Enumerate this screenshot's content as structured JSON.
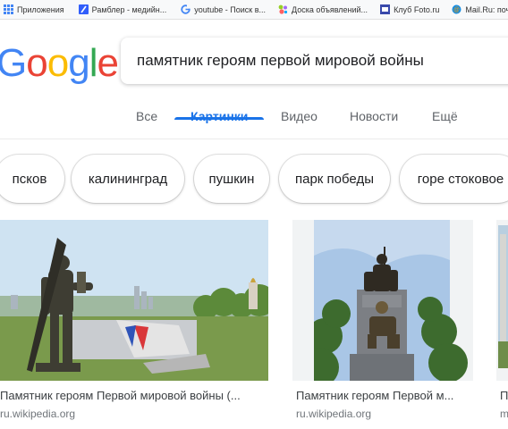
{
  "bookmarks": [
    {
      "label": "Приложения",
      "icon": "apps-grid-icon",
      "color": "#4285f4"
    },
    {
      "label": "Рамблер - медийн...",
      "icon": "rambler-icon",
      "color": "#315efb"
    },
    {
      "label": "youtube - Поиск в...",
      "icon": "google-g-icon",
      "color": "#4285f4"
    },
    {
      "label": "Доска объявлений...",
      "icon": "avito-icon",
      "color": "#e53935"
    },
    {
      "label": "Клуб Foto.ru",
      "icon": "foto-icon",
      "color": "#3949ab"
    },
    {
      "label": "Mail.Ru: почта, по...",
      "icon": "mailru-icon",
      "color": "#168de2"
    }
  ],
  "logo": {
    "letters": [
      "G",
      "o",
      "o",
      "g",
      "l",
      "e"
    ],
    "colors": [
      "#4285f4",
      "#ea4335",
      "#fbbc05",
      "#4285f4",
      "#34a853",
      "#ea4335"
    ]
  },
  "search": {
    "query": "памятник героям первой мировой войны"
  },
  "tabs": [
    {
      "label": "Все",
      "active": false
    },
    {
      "label": "Картинки",
      "active": true
    },
    {
      "label": "Видео",
      "active": false
    },
    {
      "label": "Новости",
      "active": false
    },
    {
      "label": "Ещё",
      "active": false
    }
  ],
  "chips": [
    "псков",
    "калининград",
    "пушкин",
    "парк победы",
    "горе стоковое"
  ],
  "results": [
    {
      "title": "Памятник героям Первой мировой войны (...",
      "source": "ru.wikipedia.org"
    },
    {
      "title": "Памятник героям Первой м...",
      "source": "ru.wikipedia.org"
    },
    {
      "title": "П",
      "source": "m"
    }
  ],
  "accent": "#1a73e8"
}
